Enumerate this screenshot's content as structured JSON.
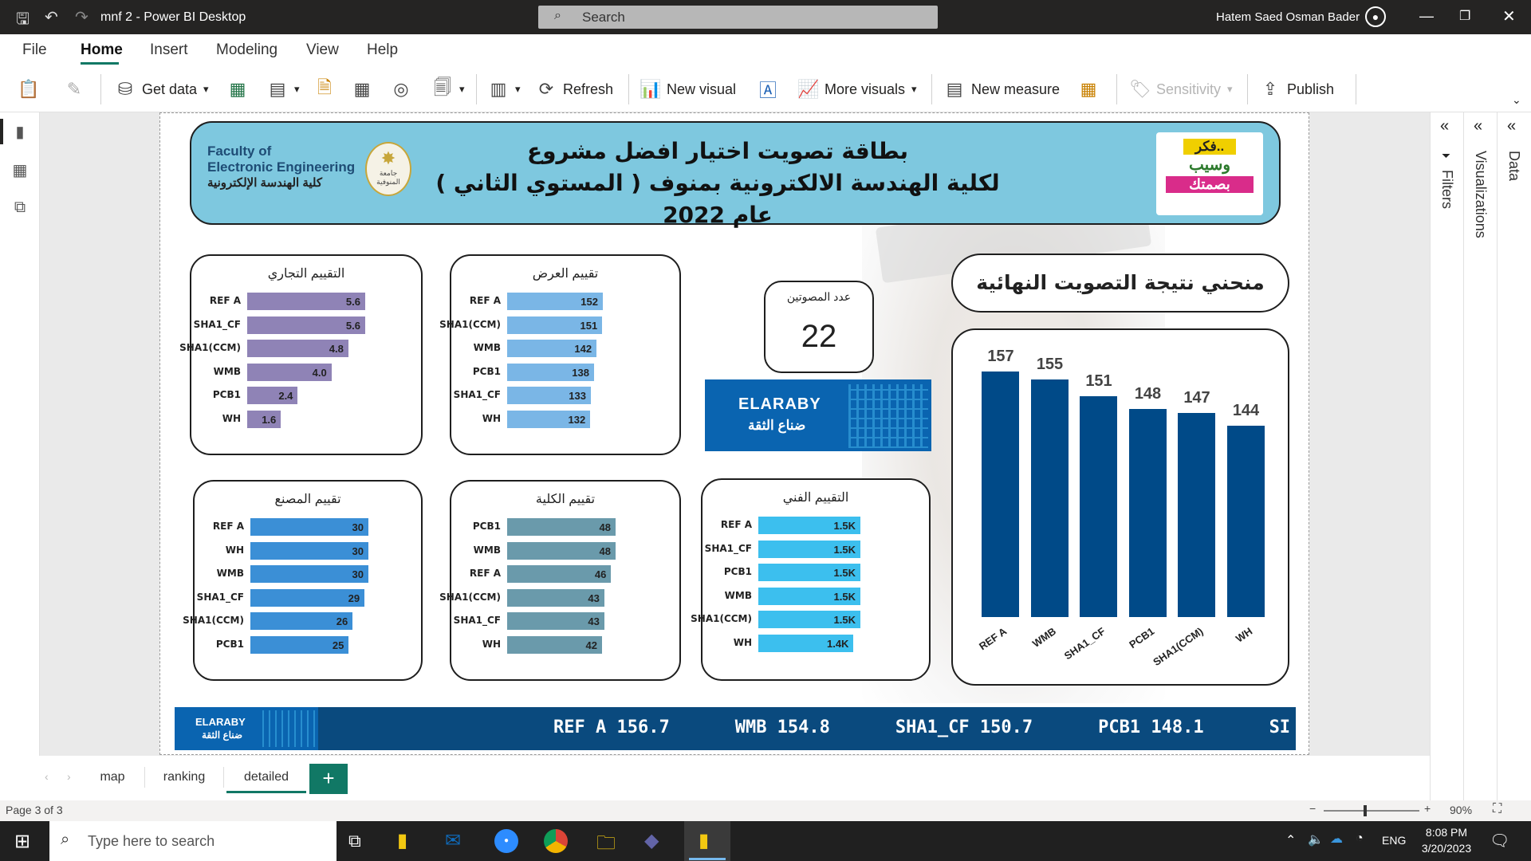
{
  "app": {
    "title": "mnf 2 - Power BI Desktop",
    "search_placeholder": "Search",
    "user": "Hatem Saed Osman Bader"
  },
  "menu": [
    "File",
    "Home",
    "Insert",
    "Modeling",
    "View",
    "Help"
  ],
  "toolbar": {
    "get_data": "Get data",
    "refresh": "Refresh",
    "new_visual": "New visual",
    "more_visuals": "More visuals",
    "new_measure": "New measure",
    "sensitivity": "Sensitivity",
    "publish": "Publish"
  },
  "right_panes": [
    "Filters",
    "Visualizations",
    "Data"
  ],
  "report": {
    "header": {
      "faculty_en_line1": "Faculty of",
      "faculty_en_line2": "Electronic Engineering",
      "faculty_ar": "كلية الهندسة الإلكترونية",
      "university_ar": "جامعة المنوفية",
      "title_line1": "بطاقة تصويت اختيار افضل مشروع",
      "title_line2": "لكلية الهندسة الالكترونية بمنوف ( المستوي الثاني ) عام 2022",
      "logo_text1": "فكر..",
      "logo_text2": "وسيب",
      "logo_text3": "بصمتك"
    },
    "voters": {
      "label": "عدد المصوتين",
      "value": "22"
    },
    "sponsor": {
      "name": "ELARABY",
      "tagline": "ضناع الثقة"
    },
    "final_title": "منحني نتيجة التصويت النهائية",
    "ticker": [
      {
        "name": "REF A",
        "value": "156.7"
      },
      {
        "name": "WMB",
        "value": "154.8"
      },
      {
        "name": "SHA1_CF",
        "value": "150.7"
      },
      {
        "name": "PCB1",
        "value": "148.1"
      },
      {
        "name": "SI",
        "value": ""
      }
    ]
  },
  "chart_data": [
    {
      "type": "bar",
      "title": "التقييم التجاري",
      "orientation": "horizontal",
      "color": "#8f83b6",
      "categories": [
        "REF A",
        "SHA1_CF",
        "SHA1(CCM)",
        "WMB",
        "PCB1",
        "WH"
      ],
      "values": [
        5.6,
        5.6,
        4.8,
        4.0,
        2.4,
        1.6
      ],
      "labels": [
        "5.6",
        "5.6",
        "4.8",
        "4.0",
        "2.4",
        "1.6"
      ],
      "xlim": [
        0,
        5.6
      ]
    },
    {
      "type": "bar",
      "title": "تقييم العرض",
      "orientation": "horizontal",
      "color": "#7ab6e6",
      "categories": [
        "REF A",
        "SHA1(CCM)",
        "WMB",
        "PCB1",
        "SHA1_CF",
        "WH"
      ],
      "values": [
        152,
        151,
        142,
        138,
        133,
        132
      ],
      "labels": [
        "152",
        "151",
        "142",
        "138",
        "133",
        "132"
      ],
      "xlim": [
        0,
        152
      ]
    },
    {
      "type": "bar",
      "title": "تقييم المصنع",
      "orientation": "horizontal",
      "color": "#3b8fd6",
      "categories": [
        "REF A",
        "WH",
        "WMB",
        "SHA1_CF",
        "SHA1(CCM)",
        "PCB1"
      ],
      "values": [
        30,
        30,
        30,
        29,
        26,
        25
      ],
      "labels": [
        "30",
        "30",
        "30",
        "29",
        "26",
        "25"
      ],
      "xlim": [
        0,
        30
      ]
    },
    {
      "type": "bar",
      "title": "تقييم الكلية",
      "orientation": "horizontal",
      "color": "#6a9aab",
      "categories": [
        "PCB1",
        "WMB",
        "REF A",
        "SHA1(CCM)",
        "SHA1_CF",
        "WH"
      ],
      "values": [
        48,
        48,
        46,
        43,
        43,
        42
      ],
      "labels": [
        "48",
        "48",
        "46",
        "43",
        "43",
        "42"
      ],
      "xlim": [
        0,
        48
      ]
    },
    {
      "type": "bar",
      "title": "التقييم الفني",
      "orientation": "horizontal",
      "color": "#3cbfee",
      "categories": [
        "REF A",
        "SHA1_CF",
        "PCB1",
        "WMB",
        "SHA1(CCM)",
        "WH"
      ],
      "values": [
        1500,
        1500,
        1500,
        1500,
        1500,
        1400
      ],
      "labels": [
        "1.5K",
        "1.5K",
        "1.5K",
        "1.5K",
        "1.5K",
        "1.4K"
      ],
      "xlim": [
        0,
        1500
      ]
    },
    {
      "type": "bar",
      "title": "",
      "orientation": "vertical",
      "color": "#004a88",
      "categories": [
        "REF A",
        "WMB",
        "SHA1_CF",
        "PCB1",
        "SHA1(CCM)",
        "WH"
      ],
      "values": [
        157,
        155,
        151,
        148,
        147,
        144
      ],
      "ylim": [
        0,
        157
      ]
    }
  ],
  "tabs": [
    "map",
    "ranking",
    "detailed"
  ],
  "active_tab": "detailed",
  "status": {
    "page": "Page 3 of 3",
    "zoom": "90%"
  },
  "taskbar": {
    "search_placeholder": "Type here to search",
    "lang": "ENG",
    "time": "8:08 PM",
    "date": "3/20/2023"
  }
}
